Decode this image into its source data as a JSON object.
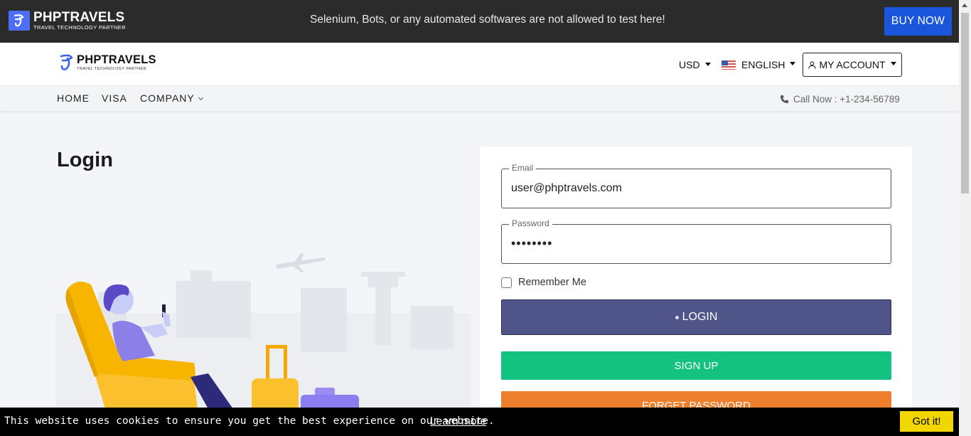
{
  "topbar": {
    "logo_title": "PHPTRAVELS",
    "logo_subtitle": "TRAVEL TECHNOLOGY PARTNER",
    "notice": "Selenium, Bots, or any automated softwares are not allowed to test here!",
    "buy_now": "BUY NOW"
  },
  "header": {
    "logo_title": "PHPTRAVELS",
    "logo_subtitle": "TRAVEL TECHNOLOGY PARTNER",
    "currency": "USD",
    "language": "ENGLISH",
    "account": "MY ACCOUNT"
  },
  "nav": {
    "items": [
      "HOME",
      "VISA",
      "COMPANY"
    ],
    "call_now": "Call Now : +1-234-56789"
  },
  "page": {
    "title": "Login"
  },
  "form": {
    "email_label": "Email",
    "email_value": "user@phptravels.com",
    "password_label": "Password",
    "password_value": "••••••••",
    "remember_me": "Remember Me",
    "login": "LOGIN",
    "signup": "SIGN UP",
    "forget_password": "FORGET PASSWORD"
  },
  "cookie": {
    "message": "This website uses cookies to ensure you get the best experience on our website.",
    "learn_more": "Learn more",
    "accept": "Got it!"
  },
  "colors": {
    "topbar_bg": "#2b2b2b",
    "buy_now": "#1a56db",
    "login_button": "#4f5588",
    "signup_button": "#13c27f",
    "forget_button": "#ee7f2d",
    "cookie_button": "#f1d600"
  }
}
